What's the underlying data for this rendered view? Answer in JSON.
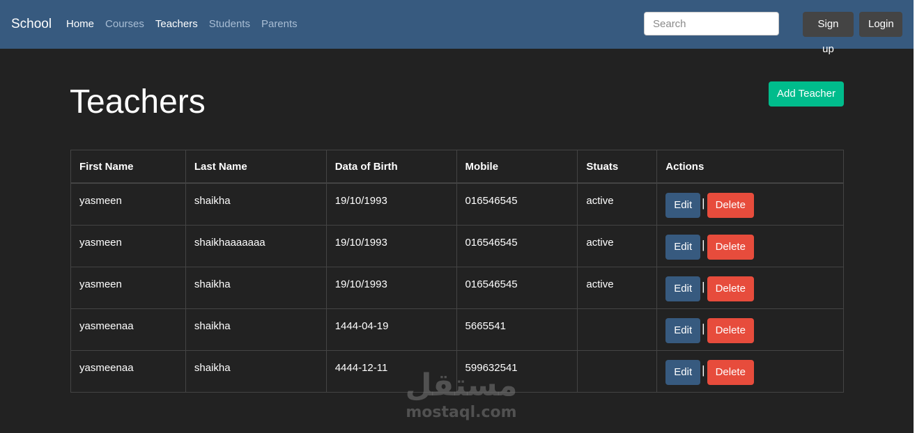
{
  "navbar": {
    "brand": "School",
    "links": [
      {
        "label": "Home",
        "active": true
      },
      {
        "label": "Courses",
        "active": false
      },
      {
        "label": "Teachers",
        "active": true
      },
      {
        "label": "Students",
        "active": false
      },
      {
        "label": "Parents",
        "active": false
      }
    ],
    "search_placeholder": "Search",
    "signup_label": "Sign up",
    "login_label": "Login"
  },
  "header": {
    "title": "Teachers",
    "add_label": "Add Teacher"
  },
  "table": {
    "columns": [
      "First Name",
      "Last Name",
      "Data of Birth",
      "Mobile",
      "Stuats",
      "Actions"
    ],
    "rows": [
      {
        "first": "yasmeen",
        "last": "shaikha",
        "dob": "19/10/1993",
        "mobile": "016546545",
        "status": "active"
      },
      {
        "first": "yasmeen",
        "last": "shaikhaaaaaaa",
        "dob": "19/10/1993",
        "mobile": "016546545",
        "status": "active"
      },
      {
        "first": "yasmeen",
        "last": "shaikha",
        "dob": "19/10/1993",
        "mobile": "016546545",
        "status": "active"
      },
      {
        "first": "yasmeenaa",
        "last": "shaikha",
        "dob": "1444-04-19",
        "mobile": "5665541",
        "status": ""
      },
      {
        "first": "yasmeenaa",
        "last": "shaikha",
        "dob": "4444-12-11",
        "mobile": "599632541",
        "status": ""
      }
    ],
    "edit_label": "Edit",
    "delete_label": "Delete",
    "separator": "|"
  },
  "watermark": {
    "logo": "مستقل",
    "text": "mostaql.com"
  },
  "colors": {
    "navbar": "#375a7f",
    "background": "#222222",
    "success": "#00bc8c",
    "danger": "#e74c3c",
    "secondary": "#444444"
  }
}
